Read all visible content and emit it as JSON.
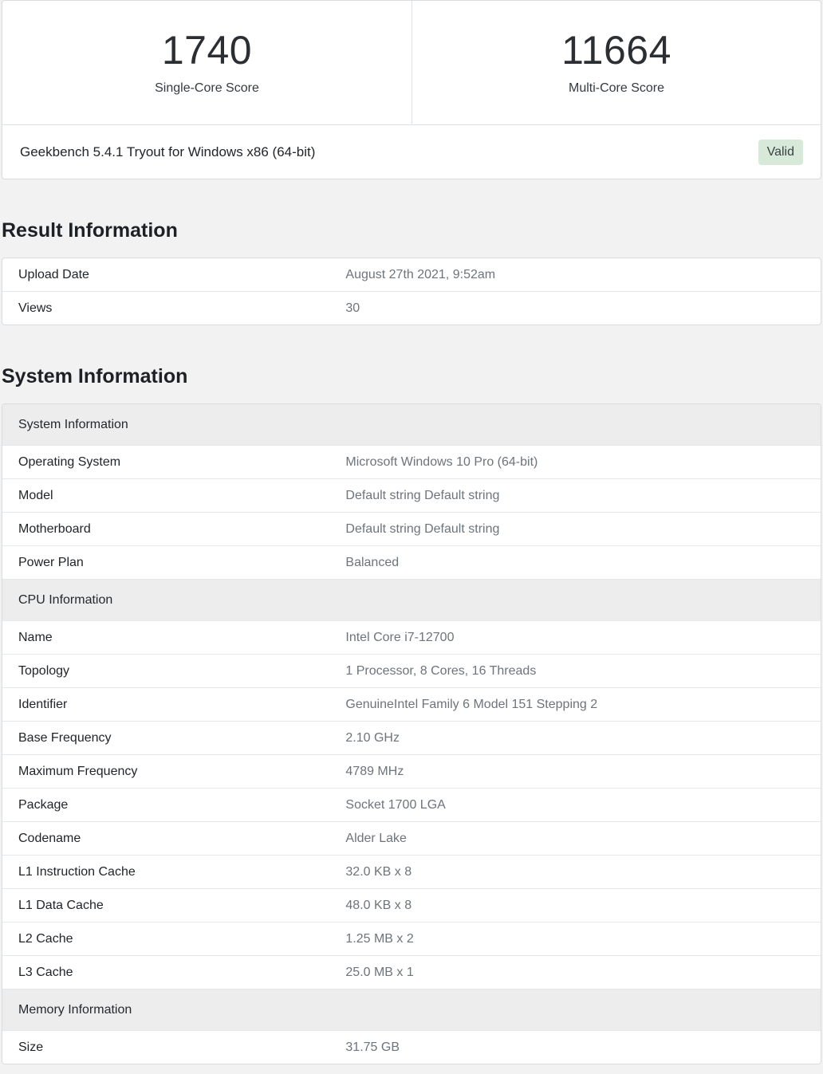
{
  "scores": {
    "single_core": {
      "value": "1740",
      "label": "Single-Core Score"
    },
    "multi_core": {
      "value": "11664",
      "label": "Multi-Core Score"
    }
  },
  "benchmark": {
    "title": "Geekbench 5.4.1 Tryout for Windows x86 (64-bit)",
    "badge_label": "Valid",
    "badge_bg": "#d7ead9",
    "badge_text_color": "#3a4145"
  },
  "result_information": {
    "heading": "Result Information",
    "rows": [
      {
        "label": "Upload Date",
        "value": "August 27th 2021, 9:52am"
      },
      {
        "label": "Views",
        "value": "30"
      }
    ]
  },
  "system_information": {
    "heading": "System Information",
    "groups": [
      {
        "header": "System Information",
        "rows": [
          {
            "label": "Operating System",
            "value": "Microsoft Windows 10 Pro (64-bit)"
          },
          {
            "label": "Model",
            "value": "Default string Default string"
          },
          {
            "label": "Motherboard",
            "value": "Default string Default string"
          },
          {
            "label": "Power Plan",
            "value": "Balanced"
          }
        ]
      },
      {
        "header": "CPU Information",
        "rows": [
          {
            "label": "Name",
            "value": "Intel Core i7-12700"
          },
          {
            "label": "Topology",
            "value": "1 Processor, 8 Cores, 16 Threads"
          },
          {
            "label": "Identifier",
            "value": "GenuineIntel Family 6 Model 151 Stepping 2"
          },
          {
            "label": "Base Frequency",
            "value": "2.10 GHz"
          },
          {
            "label": "Maximum Frequency",
            "value": "4789 MHz"
          },
          {
            "label": "Package",
            "value": "Socket 1700 LGA"
          },
          {
            "label": "Codename",
            "value": "Alder Lake"
          },
          {
            "label": "L1 Instruction Cache",
            "value": "32.0 KB x 8"
          },
          {
            "label": "L1 Data Cache",
            "value": "48.0 KB x 8"
          },
          {
            "label": "L2 Cache",
            "value": "1.25 MB x 2"
          },
          {
            "label": "L3 Cache",
            "value": "25.0 MB x 1"
          }
        ]
      },
      {
        "header": "Memory Information",
        "rows": [
          {
            "label": "Size",
            "value": "31.75 GB"
          }
        ]
      }
    ]
  }
}
